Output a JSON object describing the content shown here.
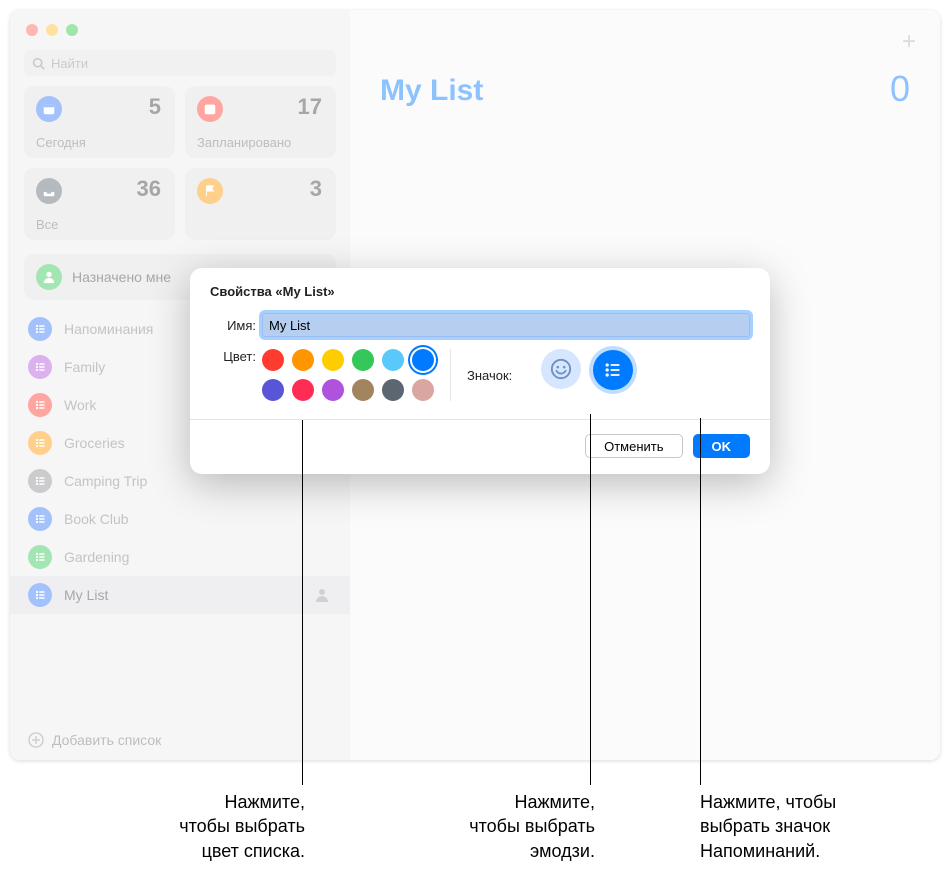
{
  "search": {
    "placeholder": "Найти"
  },
  "cards": {
    "today": {
      "label": "Сегодня",
      "count": "5",
      "color": "#3478f6"
    },
    "scheduled": {
      "label": "Запланировано",
      "count": "17",
      "color": "#ff3b30"
    },
    "all": {
      "label": "Все",
      "count": "36",
      "color": "#5b6670"
    },
    "flagged": {
      "label": "",
      "count": "3",
      "color": "#ff9500"
    }
  },
  "assigned": {
    "label": "Назначено мне"
  },
  "lists": [
    {
      "name": "Напоминания",
      "color": "#3478f6",
      "icon": "list"
    },
    {
      "name": "Family",
      "color": "#af52de",
      "icon": "home"
    },
    {
      "name": "Work",
      "color": "#ff3b30",
      "icon": "star"
    },
    {
      "name": "Groceries",
      "color": "#ff9500",
      "icon": "cart"
    },
    {
      "name": "Camping Trip",
      "color": "#8e8e93",
      "icon": "tent"
    },
    {
      "name": "Book Club",
      "color": "#3478f6",
      "icon": "bookmark"
    },
    {
      "name": "Gardening",
      "color": "#34c759",
      "icon": "leaf"
    },
    {
      "name": "My List",
      "color": "#3478f6",
      "icon": "list",
      "selected": true
    }
  ],
  "addlist": "Добавить список",
  "main": {
    "title": "My List",
    "count": "0"
  },
  "modal": {
    "title": "Свойства «My List»",
    "name_label": "Имя:",
    "name_value": "My List",
    "color_label": "Цвет:",
    "icon_label": "Значок:",
    "colors_row1": [
      "#ff3b30",
      "#ff9500",
      "#ffcc00",
      "#34c759",
      "#5ac8fa",
      "#007aff"
    ],
    "colors_row2": [
      "#5856d6",
      "#ff2d55",
      "#af52de",
      "#a2845e",
      "#5b6670",
      "#d9a6a0"
    ],
    "selected_color_index": 5,
    "cancel": "Отменить",
    "ok": "OK"
  },
  "callouts": {
    "color": "Нажмите,\nчтобы выбрать\nцвет списка.",
    "emoji": "Нажмите,\nчтобы выбрать\nэмодзи.",
    "icon": "Нажмите, чтобы\nвыбрать значок\nНапоминаний."
  }
}
